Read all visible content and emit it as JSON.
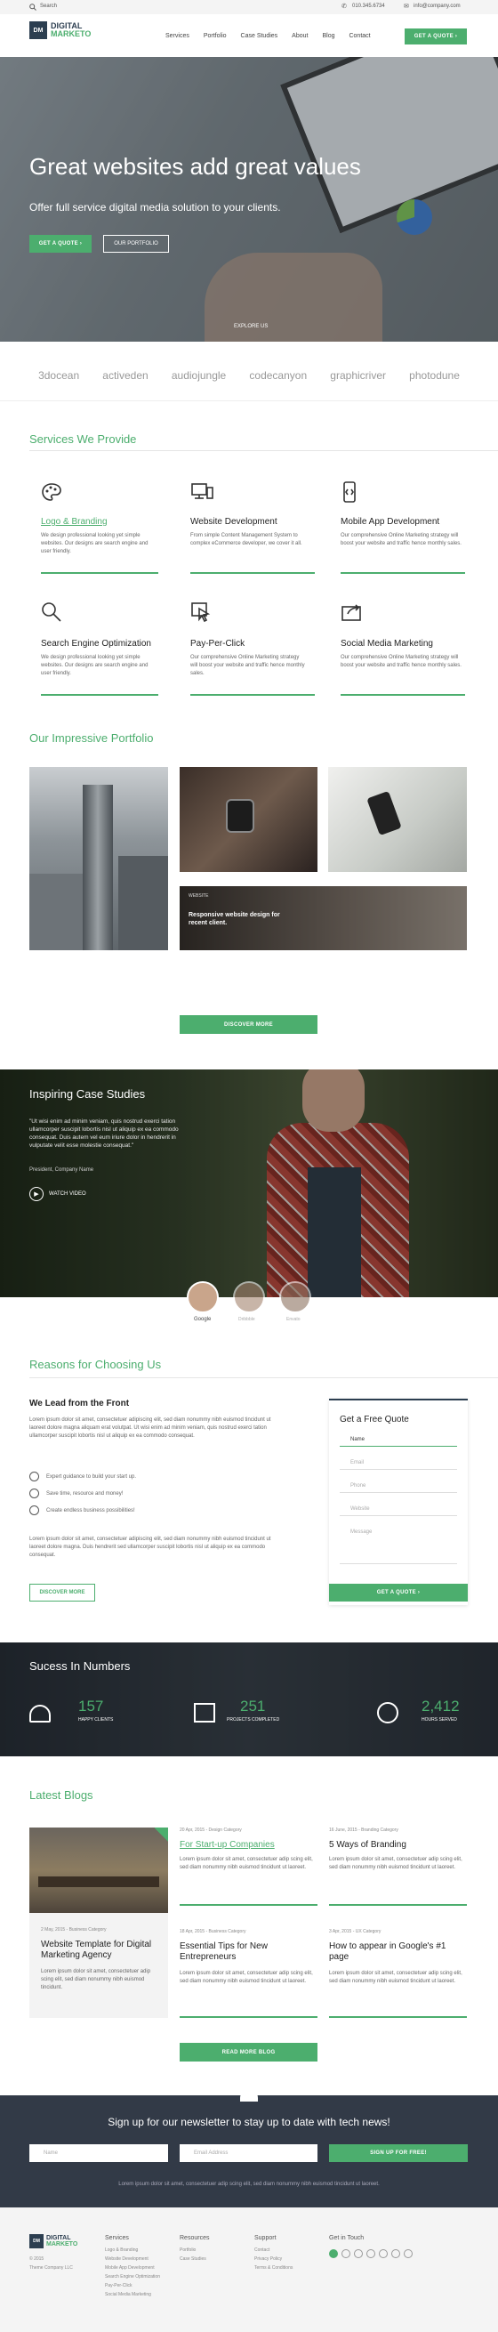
{
  "topbar": {
    "search": "Search",
    "phone": "010.345.6734",
    "email": "info@company.com"
  },
  "logo": {
    "badge": "DM",
    "line1": "DIGITAL",
    "line2": "MARKETO"
  },
  "nav": {
    "items": [
      "Services",
      "Portfolio",
      "Case Studies",
      "About",
      "Blog",
      "Contact"
    ],
    "cta": "GET A QUOTE"
  },
  "hero": {
    "title": "Great websites add great values",
    "subtitle": "Offer full service digital media solution to your clients.",
    "btn_quote": "GET A QUOTE",
    "btn_portfolio": "OUR PORTFOLIO",
    "explore": "EXPLORE US"
  },
  "brands": [
    "3docean",
    "activeden",
    "audiojungle",
    "codecanyon",
    "graphicriver",
    "photodune"
  ],
  "services": {
    "title": "Services We Provide",
    "items": [
      {
        "name": "Logo & Branding",
        "desc": "We design professional looking yet simple websites. Our designs are search engine and user friendly.",
        "icon": "palette-icon"
      },
      {
        "name": "Website Development",
        "desc": "From simple Content Management System to complex eCommerce developer, we cover it all.",
        "icon": "monitor-icon"
      },
      {
        "name": "Mobile App Development",
        "desc": "Our comprehensive Online Marketing strategy will boost your website and traffic hence monthly sales.",
        "icon": "mobile-icon"
      },
      {
        "name": "Search Engine Optimization",
        "desc": "We design professional looking yet simple websites. Our designs are search engine and user friendly.",
        "icon": "search-icon"
      },
      {
        "name": "Pay-Per-Click",
        "desc": "Our comprehensive Online Marketing strategy will boost your website and traffic hence monthly sales.",
        "icon": "cursor-icon"
      },
      {
        "name": "Social Media Marketing",
        "desc": "Our comprehensive Online Marketing strategy will boost your website and traffic hence monthly sales.",
        "icon": "share-icon"
      }
    ]
  },
  "portfolio": {
    "title": "Our Impressive Portfolio",
    "tag": "WEBSITE",
    "caption": "Responsive website design for recent client.",
    "discover": "DISCOVER",
    "more": "DISCOVER MORE"
  },
  "case": {
    "title": "Inspiring Case Studies",
    "quote": "\"Ut wisi enim ad minim veniam, quis nostrud exerci tation ullamcorper suscipit lobortis nisl ut aliquip ex ea commodo consequat. Duis autem vel eum iriure dolor in hendrerit in vulputate velit esse molestie consequat.\"",
    "author": "President, Company Name",
    "video": "WATCH VIDEO",
    "clients": [
      "Google",
      "Dribbble",
      "Envato"
    ]
  },
  "reasons": {
    "title": "Reasons for Choosing Us",
    "subtitle": "We Lead from the Front",
    "para1": "Lorem ipsum dolor sit amet, consectetuer adipiscing elit, sed diam nonummy nibh euismod tincidunt ut laoreet dolore magna aliquam erat volutpat. Ut wisi enim ad minim veniam, quis nostrud exerci tation ullamcorper suscipit lobortis nisl ut aliquip ex ea commodo consequat.",
    "bullets": [
      "Expert guidance to build your start up.",
      "Save time, resource and money!",
      "Create endless business possibilities!"
    ],
    "para2": "Lorem ipsum dolor sit amet, consectetuer adipiscing elit, sed diam nonummy nibh euismod tincidunt ut laoreet dolore magna. Duis hendrerit sed ullamcorper suscipit lobortis nisl ut aliquip ex ea commodo consequat.",
    "btn": "DISCOVER MORE"
  },
  "quote_form": {
    "title": "Get a Free Quote",
    "fields": [
      "Name",
      "Email",
      "Phone",
      "Website",
      "Message"
    ],
    "btn": "GET A QUOTE"
  },
  "numbers": {
    "title": "Sucess In Numbers",
    "items": [
      {
        "value": "157",
        "label": "HAPPY CLIENTS"
      },
      {
        "value": "251",
        "label": "PROJECTS COMPLETED"
      },
      {
        "value": "2,412",
        "label": "HOURS SERVED"
      }
    ]
  },
  "blogs": {
    "title": "Latest Blogs",
    "posts": [
      {
        "meta": "2 May, 2015 - Business Category",
        "title": "Website Template for Digital Marketing Agency",
        "desc": "Lorem ipsum dolor sit amet, consectetuer adip scing elit, sed diam nonummy nibh euismod tincidunt."
      },
      {
        "meta": "20 Apr, 2015 - Design Category",
        "title": "For Start-up Companies",
        "desc": "Lorem ipsum dolor sit amet, consectetuer adip scing elit, sed diam nonummy nibh euismod tincidunt ut laoreet."
      },
      {
        "meta": "16 June, 2015 - Branding Category",
        "title": "5 Ways of Branding",
        "desc": "Lorem ipsum dolor sit amet, consectetuer adip scing elit, sed diam nonummy nibh euismod tincidunt ut laoreet."
      },
      {
        "meta": "18 Apr, 2015 - Business Category",
        "title": "Essential Tips for New Entrepreneurs",
        "desc": "Lorem ipsum dolor sit amet, consectetuer adip scing elit, sed diam nonummy nibh euismod tincidunt ut laoreet."
      },
      {
        "meta": "3 Apr, 2015 - UX Category",
        "title": "How to appear in Google's #1 page",
        "desc": "Lorem ipsum dolor sit amet, consectetuer adip scing elit, sed diam nonummy nibh euismod tincidunt ut laoreet."
      }
    ],
    "more": "READ MORE BLOG"
  },
  "newsletter": {
    "title": "Sign up for our newsletter to stay up to date with tech news!",
    "name_ph": "Name",
    "email_ph": "Email Address",
    "btn": "SIGN UP FOR FREE!",
    "note": "Lorem ipsum dolor sit amet, consectetuer adip scing elit, sed diam nonummy nibh euismod tincidunt ut laoreet."
  },
  "footer": {
    "copy1": "© 2015",
    "copy2": "Theme Company LLC",
    "cols": [
      {
        "head": "Services",
        "links": [
          "Logo & Branding",
          "Website Development",
          "Mobile App Development",
          "Search Engine Optimization",
          "Pay-Per-Click",
          "Social Media Marketing"
        ]
      },
      {
        "head": "Resources",
        "links": [
          "Portfolio",
          "Case Studies"
        ]
      },
      {
        "head": "Support",
        "links": [
          "Contact",
          "Privacy Policy",
          "Terms & Conditions"
        ]
      }
    ],
    "touch": "Get in Touch"
  }
}
